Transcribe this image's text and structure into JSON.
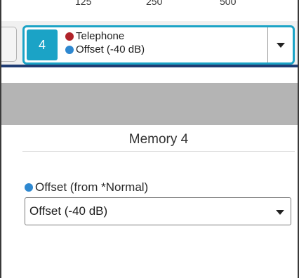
{
  "scale": {
    "labels": [
      "125",
      "250",
      "500"
    ]
  },
  "memory_selector": {
    "number": "4",
    "programs": [
      {
        "label": "Telephone",
        "dot_color": "#b0232a"
      },
      {
        "label": "Offset (-40 dB)",
        "dot_color": "#2e88d0"
      }
    ]
  },
  "memory_panel": {
    "title": "Memory 4",
    "program_label": "Offset (from *Normal)",
    "program_dot_color": "#2e88d0",
    "program_selected": "Offset (-40 dB)"
  },
  "colors": {
    "accent": "#1ba3c6",
    "divider": "#1f3c73",
    "band": "#b4b4b4"
  },
  "icons": {
    "dropdown": "chevron-down-icon",
    "dot": "color-dot-icon"
  }
}
